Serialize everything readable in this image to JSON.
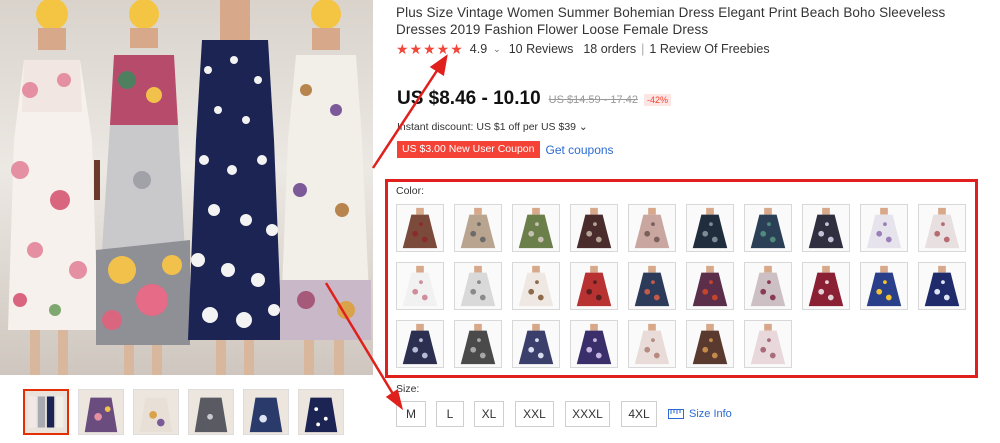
{
  "product": {
    "title": "Plus Size Vintage Women Summer Bohemian Dress Elegant Print Beach Boho Sleeveless Dresses 2019 Fashion Flower Loose Female Dress",
    "rating": {
      "stars": "★★★★★",
      "value": "4.9",
      "caret": "⌄",
      "reviews": "10 Reviews",
      "orders": "18 orders",
      "separator": "|",
      "freebies": "1 Review Of Freebies"
    },
    "price": {
      "current": "US $8.46 - 10.10",
      "original": "US $14.59 - 17.42",
      "discount": "-42%"
    },
    "instant_discount": "Instant discount: US $1 off per US $39 ⌄",
    "coupon": {
      "badge": "US $3.00 New User Coupon",
      "link": "Get coupons"
    }
  },
  "color": {
    "label": "Color:",
    "swatches": [
      {
        "name": "Color 1",
        "main": "#7b4a3a",
        "accent": "#8a2c2c"
      },
      {
        "name": "Color 2",
        "main": "#b9a48f",
        "accent": "#6b6b6b"
      },
      {
        "name": "Color 3",
        "main": "#6a7f4a",
        "accent": "#c7c0b0"
      },
      {
        "name": "Color 4",
        "main": "#4a2c2c",
        "accent": "#b5a496"
      },
      {
        "name": "Color 5",
        "main": "#c9a7a0",
        "accent": "#7a5f5a"
      },
      {
        "name": "Color 6",
        "main": "#1f2d3d",
        "accent": "#7c8a94"
      },
      {
        "name": "Color 7",
        "main": "#2b4057",
        "accent": "#4f8a7c"
      },
      {
        "name": "Color 8",
        "main": "#2f2f3f",
        "accent": "#c4c0d8"
      },
      {
        "name": "Color 9",
        "main": "#e7e3ec",
        "accent": "#9a7fb8"
      },
      {
        "name": "Color 10",
        "main": "#e8dfe0",
        "accent": "#b96b72"
      },
      {
        "name": "Color 11",
        "main": "#f1f1f1",
        "accent": "#d18c99"
      },
      {
        "name": "Color 12",
        "main": "#d9d9d9",
        "accent": "#8a8a8a"
      },
      {
        "name": "Color 13",
        "main": "#efe7e1",
        "accent": "#8b6b4a"
      },
      {
        "name": "Color 14",
        "main": "#b83232",
        "accent": "#5a2020"
      },
      {
        "name": "Color 15",
        "main": "#2c3b5a",
        "accent": "#c45a4a"
      },
      {
        "name": "Color 16",
        "main": "#5b2f4a",
        "accent": "#c4452b"
      },
      {
        "name": "Color 17",
        "main": "#ccc0c4",
        "accent": "#8b3a55"
      },
      {
        "name": "Color 18",
        "main": "#8b2035",
        "accent": "#e1d2d6"
      },
      {
        "name": "Color 19",
        "main": "#2a3f8a",
        "accent": "#f2c230"
      },
      {
        "name": "Color 20",
        "main": "#1f2b6b",
        "accent": "#dfe4f5"
      },
      {
        "name": "Color 21",
        "main": "#2c2f4f",
        "accent": "#b6bcd4"
      },
      {
        "name": "Color 22",
        "main": "#4a4a4a",
        "accent": "#a7a7a7"
      },
      {
        "name": "Color 23",
        "main": "#3a3f6b",
        "accent": "#d8dcef"
      },
      {
        "name": "Color 24",
        "main": "#3a2f6b",
        "accent": "#c7b4e0"
      },
      {
        "name": "Color 25",
        "main": "#e9dcd8",
        "accent": "#b58b80"
      },
      {
        "name": "Color 26",
        "main": "#5a3a2f",
        "accent": "#c48a4a"
      },
      {
        "name": "Color 27",
        "main": "#e8d8dc",
        "accent": "#a86b7a"
      }
    ]
  },
  "size": {
    "label": "Size:",
    "options": [
      "M",
      "L",
      "XL",
      "XXL",
      "XXXL",
      "4XL"
    ],
    "info": "Size Info"
  },
  "gallery": {
    "thumbnails": 6
  },
  "colors": {
    "accent_red": "#e0201c",
    "coupon_red": "#f44336",
    "link_blue": "#2b6bd1",
    "star_red": "#f1473b"
  }
}
